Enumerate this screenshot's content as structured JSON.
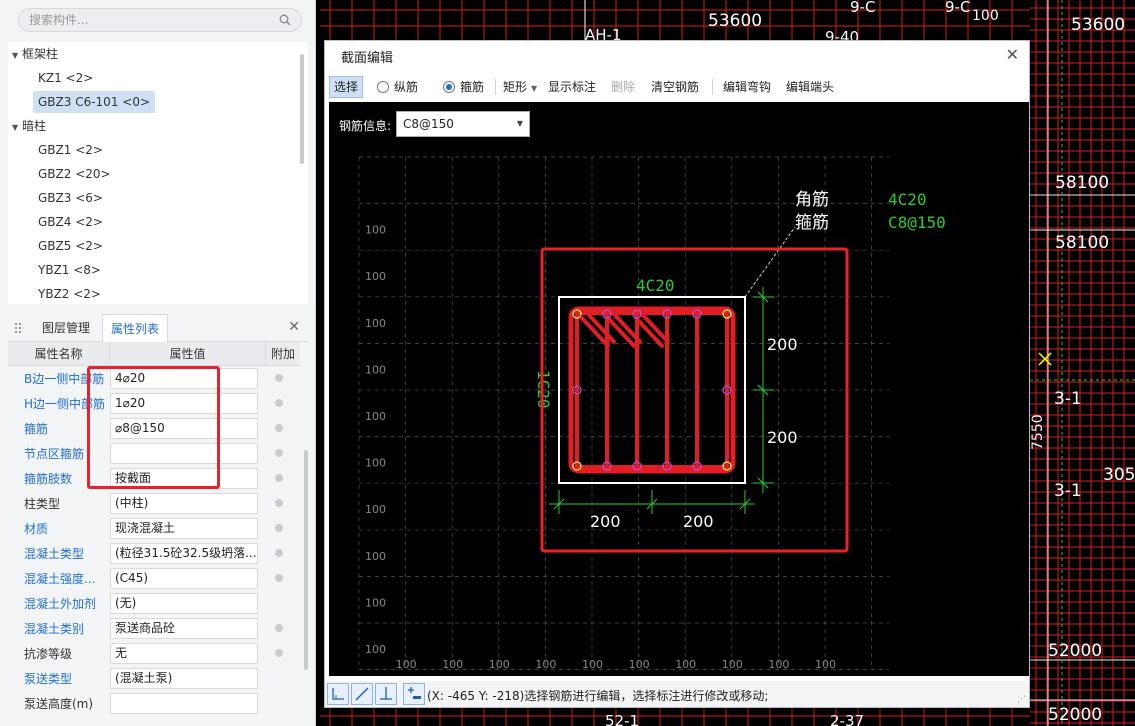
{
  "search": {
    "placeholder": "搜索构件..."
  },
  "tree": {
    "groups": [
      {
        "label": "框架柱",
        "items": [
          "KZ1 <2>",
          "GBZ3 C6-101 <0>"
        ]
      },
      {
        "label": "暗柱",
        "items": [
          "GBZ1 <2>",
          "GBZ2 <20>",
          "GBZ3 <6>",
          "GBZ4 <2>",
          "GBZ5 <2>",
          "YBZ1 <8>",
          "YBZ2 <2>"
        ]
      }
    ],
    "selected": "GBZ3 C6-101 <0>"
  },
  "panel_tabs": {
    "layer_mgmt": "图层管理",
    "prop_list": "属性列表"
  },
  "prop_table": {
    "headers": {
      "name": "属性名称",
      "value": "属性值",
      "extra": "附加"
    },
    "rows": [
      {
        "name": "B边一侧中部筋",
        "value": "4⌀20",
        "name_color": "blue",
        "radio": true
      },
      {
        "name": "H边一侧中部筋",
        "value": "1⌀20",
        "name_color": "blue",
        "radio": true
      },
      {
        "name": "箍筋",
        "value": "⌀8@150",
        "name_color": "blue",
        "radio": true
      },
      {
        "name": "节点区箍筋",
        "value": "",
        "name_color": "blue",
        "radio": true
      },
      {
        "name": "箍筋肢数",
        "value": "按截面",
        "name_color": "blue",
        "radio": true
      },
      {
        "name": "柱类型",
        "value": "(中柱)",
        "name_color": "black",
        "radio": true
      },
      {
        "name": "材质",
        "value": "现浇混凝土",
        "name_color": "blue",
        "radio": true
      },
      {
        "name": "混凝土类型",
        "value": "(粒径31.5砼32.5级坍落...",
        "name_color": "blue",
        "radio": true
      },
      {
        "name": "混凝土强度...",
        "value": "(C45)",
        "name_color": "blue",
        "radio": true
      },
      {
        "name": "混凝土外加剂",
        "value": "(无)",
        "name_color": "blue",
        "radio": false
      },
      {
        "name": "混凝土类别",
        "value": "泵送商品砼",
        "name_color": "blue",
        "radio": true
      },
      {
        "name": "抗渗等级",
        "value": "无",
        "name_color": "black",
        "radio": true
      },
      {
        "name": "泵送类型",
        "value": "(混凝土泵)",
        "name_color": "blue",
        "radio": false
      },
      {
        "name": "泵送高度(m)",
        "value": "",
        "name_color": "black",
        "radio": false
      }
    ]
  },
  "dialog": {
    "title": "截面编辑",
    "toolbar": {
      "select": "选择",
      "longitudinal": "纵筋",
      "stirrup": "箍筋",
      "shape": "矩形",
      "show_dims": "显示标注",
      "delete": "删除",
      "clear": "清空钢筋",
      "edit_hook": "编辑弯钩",
      "edit_end": "编辑端头"
    },
    "rebar_info_label": "钢筋信息:",
    "rebar_info_value": "C8@150",
    "status_text": "(X: -465 Y: -218)选择钢筋进行编辑，选择标注进行修改或移动;"
  },
  "section": {
    "corner_label": "角筋",
    "stirrup_label": "箍筋",
    "corner_value": "4C20",
    "stirrup_value": "C8@150",
    "top_bar": "4C20",
    "side_bar": "1C20",
    "dim_right_1": "200",
    "dim_right_2": "200",
    "dim_bottom_1": "200",
    "dim_bottom_2": "200",
    "grid_label": "100"
  },
  "cad_labels": [
    "53600",
    "53600",
    "9-40",
    "AH-1",
    "9-C",
    "9-C",
    "100",
    "58100",
    "58100",
    "3-1",
    "3-1",
    "7550",
    "3050",
    "52000",
    "52000",
    "2-37",
    "52-1"
  ]
}
